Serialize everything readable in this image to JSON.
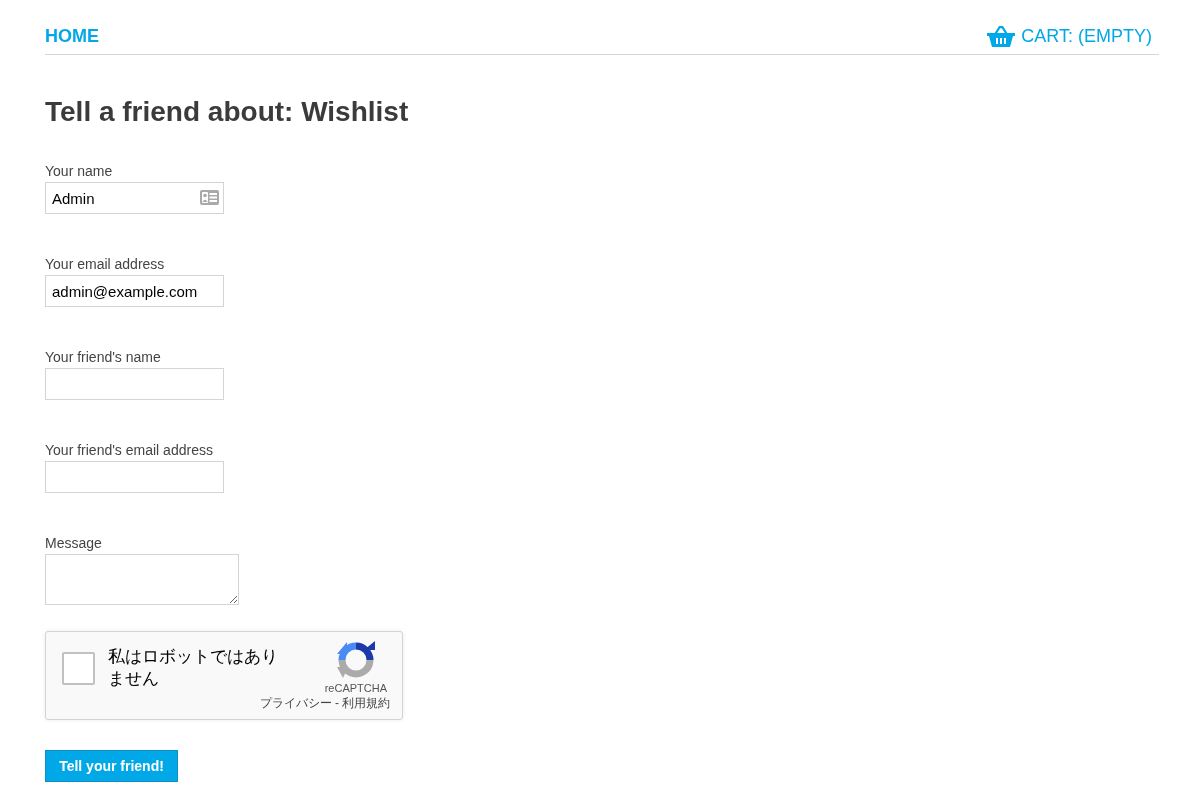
{
  "header": {
    "home_link": "HOME",
    "cart_link": "CART: (EMPTY)"
  },
  "title": "Tell a friend about: Wishlist",
  "form": {
    "fields": [
      {
        "kind": "input",
        "label": "Your name",
        "value": "Admin",
        "contact_card_icon": true
      },
      {
        "kind": "input",
        "label": "Your email address",
        "value": "admin@example.com"
      },
      {
        "kind": "input",
        "label": "Your friend's name"
      },
      {
        "kind": "input",
        "label": "Your friend's email address"
      },
      {
        "kind": "textarea",
        "label": "Message"
      }
    ]
  },
  "captcha": {
    "checked": false,
    "label": "私はロボットではありません",
    "brand": "reCAPTCHA",
    "privacy_link": "プライバシー",
    "separator": "-",
    "terms_link": "利用規約"
  },
  "submit_button": "Tell your friend!"
}
